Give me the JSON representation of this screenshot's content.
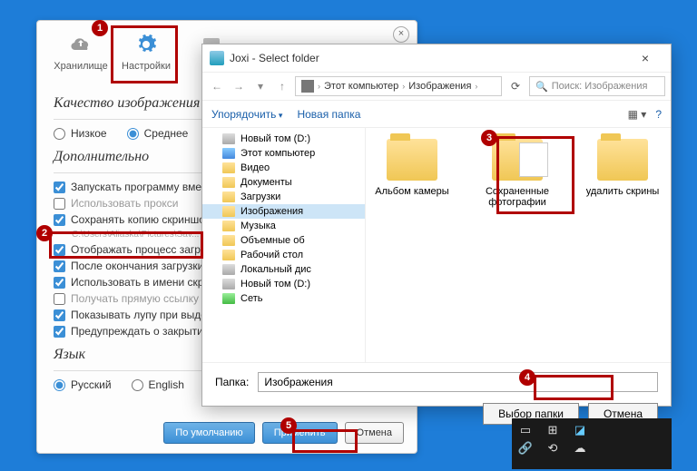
{
  "settings": {
    "close": "×",
    "tabs": {
      "storage": "Хранилище",
      "settings": "Настройки"
    },
    "quality": {
      "title": "Качество изображения",
      "low": "Низкое",
      "medium": "Среднее"
    },
    "advanced": {
      "title": "Дополнительно",
      "autostart": "Запускать программу вместе",
      "proxy": "Использовать прокси",
      "savecopy": "Сохранять копию скриншота",
      "savecopy_sub": "C:\\Users\\Aliaska\\Pictures\\Sav...",
      "progress": "Отображать процесс загрузки",
      "afterupload": "После окончания загрузки вы",
      "usename": "Использовать в имени скрин",
      "directlink": "Получать прямую ссылку на",
      "magnifier": "Показывать лупу при выделе",
      "warnclose": "Предупреждать о закрытии п"
    },
    "lang": {
      "title": "Язык",
      "ru": "Русский",
      "en": "English"
    },
    "buttons": {
      "default": "По умолчанию",
      "apply": "Применить",
      "cancel": "Отмена"
    }
  },
  "dialog": {
    "title": "Joxi - Select folder",
    "breadcrumb": {
      "pc": "Этот компьютер",
      "folder": "Изображения"
    },
    "search_placeholder": "Поиск: Изображения",
    "toolbar": {
      "organize": "Упорядочить",
      "newfolder": "Новая папка"
    },
    "tree": [
      {
        "label": "Новый том (D:)",
        "icon": "drive"
      },
      {
        "label": "Этот компьютер",
        "icon": "pc"
      },
      {
        "label": "Видео",
        "icon": "folder"
      },
      {
        "label": "Документы",
        "icon": "folder"
      },
      {
        "label": "Загрузки",
        "icon": "folder"
      },
      {
        "label": "Изображения",
        "icon": "folder",
        "selected": true
      },
      {
        "label": "Музыка",
        "icon": "folder"
      },
      {
        "label": "Объемные об",
        "icon": "folder"
      },
      {
        "label": "Рабочий стол",
        "icon": "folder"
      },
      {
        "label": "Локальный дис",
        "icon": "drive"
      },
      {
        "label": "Новый том (D:)",
        "icon": "drive"
      },
      {
        "label": "Сеть",
        "icon": "net"
      }
    ],
    "folders": [
      {
        "name": "Альбом камеры"
      },
      {
        "name": "Сохраненные фотографии",
        "preview": true
      },
      {
        "name": "удалить скрины"
      }
    ],
    "field_label": "Папка:",
    "field_value": "Изображения",
    "select": "Выбор папки",
    "cancel": "Отмена",
    "close": "×"
  },
  "callouts": {
    "1": "1",
    "2": "2",
    "3": "3",
    "4": "4",
    "5": "5"
  }
}
